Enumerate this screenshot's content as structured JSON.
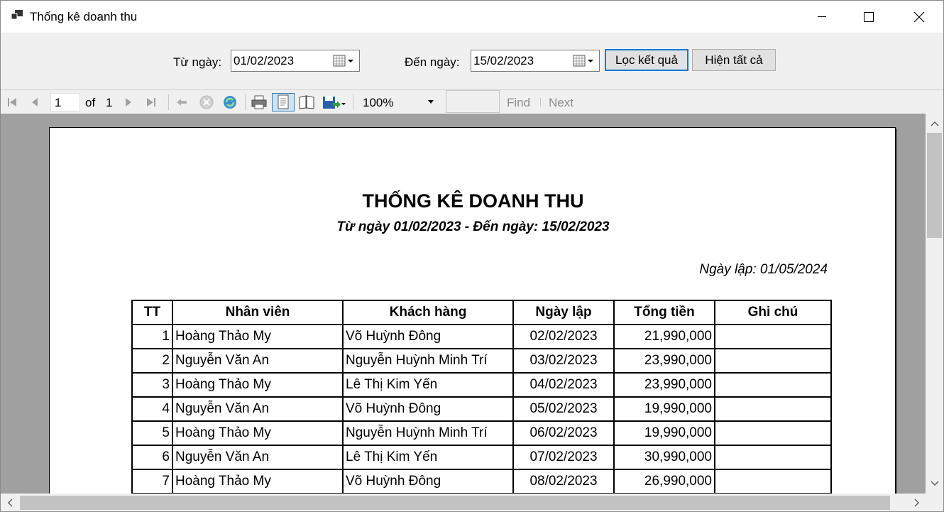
{
  "window": {
    "title": "Thống kê doanh thu"
  },
  "filter": {
    "from_label": "Từ ngày:",
    "from_value": "01/02/2023",
    "to_label": "Đến ngày:",
    "to_value": "15/02/2023",
    "filter_button": "Lọc kết quả",
    "show_all_button": "Hiện tất cả"
  },
  "toolbar": {
    "current_page": "1",
    "of_label": "of",
    "total_pages": "1",
    "zoom": "100%",
    "find_label": "Find",
    "next_label": "Next"
  },
  "report": {
    "title": "THỐNG KÊ DOANH THU",
    "subtitle": "Từ ngày 01/02/2023 - Đến ngày: 15/02/2023",
    "created": "Ngày lập: 01/05/2024",
    "columns": [
      "TT",
      "Nhân viên",
      "Khách hàng",
      "Ngày lập",
      "Tổng tiền",
      "Ghi chú"
    ],
    "rows": [
      [
        "1",
        "Hoàng Thảo My",
        "Võ Huỳnh Đông",
        "02/02/2023",
        "21,990,000",
        ""
      ],
      [
        "2",
        "Nguyễn Văn An",
        "Nguyễn Huỳnh Minh Trí",
        "03/02/2023",
        "23,990,000",
        ""
      ],
      [
        "3",
        "Hoàng Thảo My",
        "Lê Thị Kim Yến",
        "04/02/2023",
        "23,990,000",
        ""
      ],
      [
        "4",
        "Nguyễn Văn An",
        "Võ Huỳnh Đông",
        "05/02/2023",
        "19,990,000",
        ""
      ],
      [
        "5",
        "Hoàng Thảo My",
        "Nguyễn Huỳnh Minh Trí",
        "06/02/2023",
        "19,990,000",
        ""
      ],
      [
        "6",
        "Nguyễn Văn An",
        "Lê Thị Kim Yến",
        "07/02/2023",
        "30,990,000",
        ""
      ],
      [
        "7",
        "Hoàng Thảo My",
        "Võ Huỳnh Đông",
        "08/02/2023",
        "26,990,000",
        ""
      ]
    ]
  }
}
